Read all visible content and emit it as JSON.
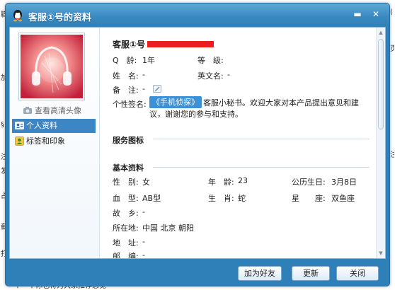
{
  "window": {
    "title": "客服①号的资料"
  },
  "profile": {
    "name": "客服①号",
    "qage_label": "Q　龄:",
    "qage_value": "1年",
    "level_label": "等　级:",
    "fullname_label": "姓　名:",
    "fullname_value": "-",
    "english_name_label": "英文名:",
    "english_name_value": "-",
    "remark_label": "备　注:",
    "remark_value": "-",
    "signature_label": "个性签名:",
    "signature_tag": "《手机侦探》",
    "signature_text": "客服小秘书。欢迎大家对本产品提出意见和建议，谢谢您的参与和支持。"
  },
  "sidebar": {
    "view_hd_avatar": "查看高清头像",
    "items": [
      {
        "label": "个人资料",
        "selected": true,
        "icon": "person-card-icon"
      },
      {
        "label": "标签和印象",
        "selected": false,
        "icon": "tag-user-icon"
      }
    ]
  },
  "sections": {
    "service_icons": "服务图标",
    "basic_info": "基本资料"
  },
  "basic": {
    "gender_label": "性　别:",
    "gender_value": "女",
    "age_label": "年　龄:",
    "age_value": "23",
    "birthday_label": "公历生日:",
    "birthday_value": "3月8日",
    "blood_label": "血　型:",
    "blood_value": "AB型",
    "zodiac_label": "生　肖:",
    "zodiac_value": "蛇",
    "sign_label": "星　　座:",
    "sign_value": "双鱼座",
    "hometown_label": "故　乡:",
    "hometown_value": "-",
    "location_label": "所在地:",
    "location_value": "中国 北京 朝阳",
    "address_label": "地　址:",
    "address_value": "-",
    "postcode_label": "邮　编:",
    "postcode_value": "-"
  },
  "buttons": {
    "add_friend": "加为好友",
    "refresh": "更新",
    "close": "关闭"
  },
  "background": {
    "bottom_text": "个一个你也将为大家推荐感觉"
  },
  "colors": {
    "titlebar": "#3b8bc2",
    "selection": "#3d86c6",
    "redaction": "#ee1c1c",
    "signature_tag": "#3d8fd6"
  }
}
